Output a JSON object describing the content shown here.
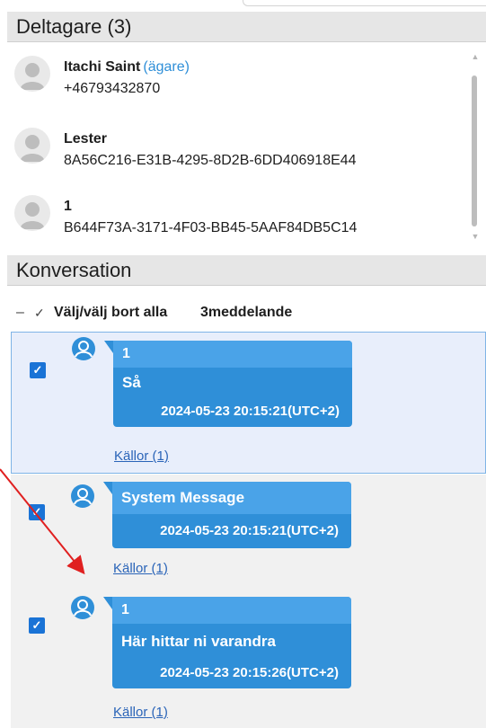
{
  "participants_section": {
    "title": "Deltagare (3)",
    "items": [
      {
        "name": "Itachi Saint",
        "role": "(ägare)",
        "id": "+46793432870"
      },
      {
        "name": "Lester",
        "role": "",
        "id": "8A56C216-E31B-4295-8D2B-6DD406918E44"
      },
      {
        "name": "1",
        "role": "",
        "id": "B644F73A-3171-4F03-BB45-5AAF84DB5C14"
      }
    ]
  },
  "conversation": {
    "title": "Konversation",
    "select_all": {
      "dash": "–",
      "check": "✓",
      "label": "Välj/välj bort alla",
      "count": "3meddelande"
    },
    "messages": [
      {
        "sender": "1",
        "text": "Så",
        "time": "2024-05-23 20:15:21(UTC+2)",
        "sources": "Källor (1)",
        "checked": true,
        "selected": true,
        "check_glyph": "✓"
      },
      {
        "sender": "System Message",
        "text": "",
        "time": "2024-05-23 20:15:21(UTC+2)",
        "sources": "Källor (1)",
        "checked": true,
        "selected": false,
        "check_glyph": "✓"
      },
      {
        "sender": "1",
        "text": "Här hittar ni varandra",
        "time": "2024-05-23 20:15:26(UTC+2)",
        "sources": "Källor (1)",
        "checked": true,
        "selected": false,
        "check_glyph": "✓"
      }
    ]
  },
  "colors": {
    "accent": "#2f8fd8",
    "checkbox": "#1a73d6",
    "selection_bg": "#e8eefb",
    "arrow": "#e02020"
  },
  "scroll": {
    "up": "▲",
    "down": "▼"
  }
}
